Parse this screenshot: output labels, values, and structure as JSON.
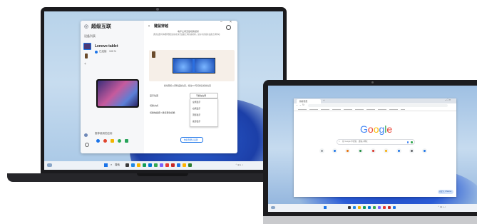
{
  "big_laptop": {
    "app": {
      "title": "超级互联",
      "win_min": "–",
      "win_close": "×",
      "device_list_label": "设备列表",
      "device_name": "Lenovo tablet",
      "device_status": "已连接",
      "device_battery": "100 %",
      "add_device": "+",
      "recommend_label": "推荐使用的应用",
      "back_icon": "chevron-left-icon",
      "panel_title": "键鼠穿越",
      "desc_line1": "电平之间无缝切换鼠标",
      "desc_line2": "通过设置可将相同键盘鼠标在多台设备之间自由切换，鼠标可直接在设备之间移动",
      "layout_hint": "拖动图标以调整设备位置，按住Ctrl可切换鼠标的位置",
      "row_position": "显示位置",
      "row_position_value": "平板在右侧",
      "row_switch": "切换方式",
      "row_shortcut": "切换快捷键 / 鼠标滑动切换",
      "options": [
        "左侧显示",
        "右侧显示",
        "顶部显示",
        "底部显示"
      ],
      "footer_button": "恢复到默认设置"
    },
    "taskbar": {
      "search_label": "搜索",
      "tray_time": "00:00"
    }
  },
  "small_laptop": {
    "chrome": {
      "tab_title": "新标签页",
      "omnibox_placeholder": "在 Google 中搜索，或输入网址",
      "logo_letters": [
        "G",
        "o",
        "o",
        "g",
        "l",
        "e"
      ],
      "logo_colors": [
        "#4285f4",
        "#ea4335",
        "#fbbc05",
        "#4285f4",
        "#34a853",
        "#ea4335"
      ],
      "customize_button": "自定义 Chrome",
      "shortcut_colors": [
        "#9aa0a6",
        "#1a73e8",
        "#e8710a",
        "#1e8e3e",
        "#d93025",
        "#f9ab00",
        "#1a73e8",
        "#5f6368",
        "#1a73e8"
      ]
    }
  },
  "colors": {
    "accent": "#1a73e8",
    "taskbar": "#eef2f7"
  }
}
